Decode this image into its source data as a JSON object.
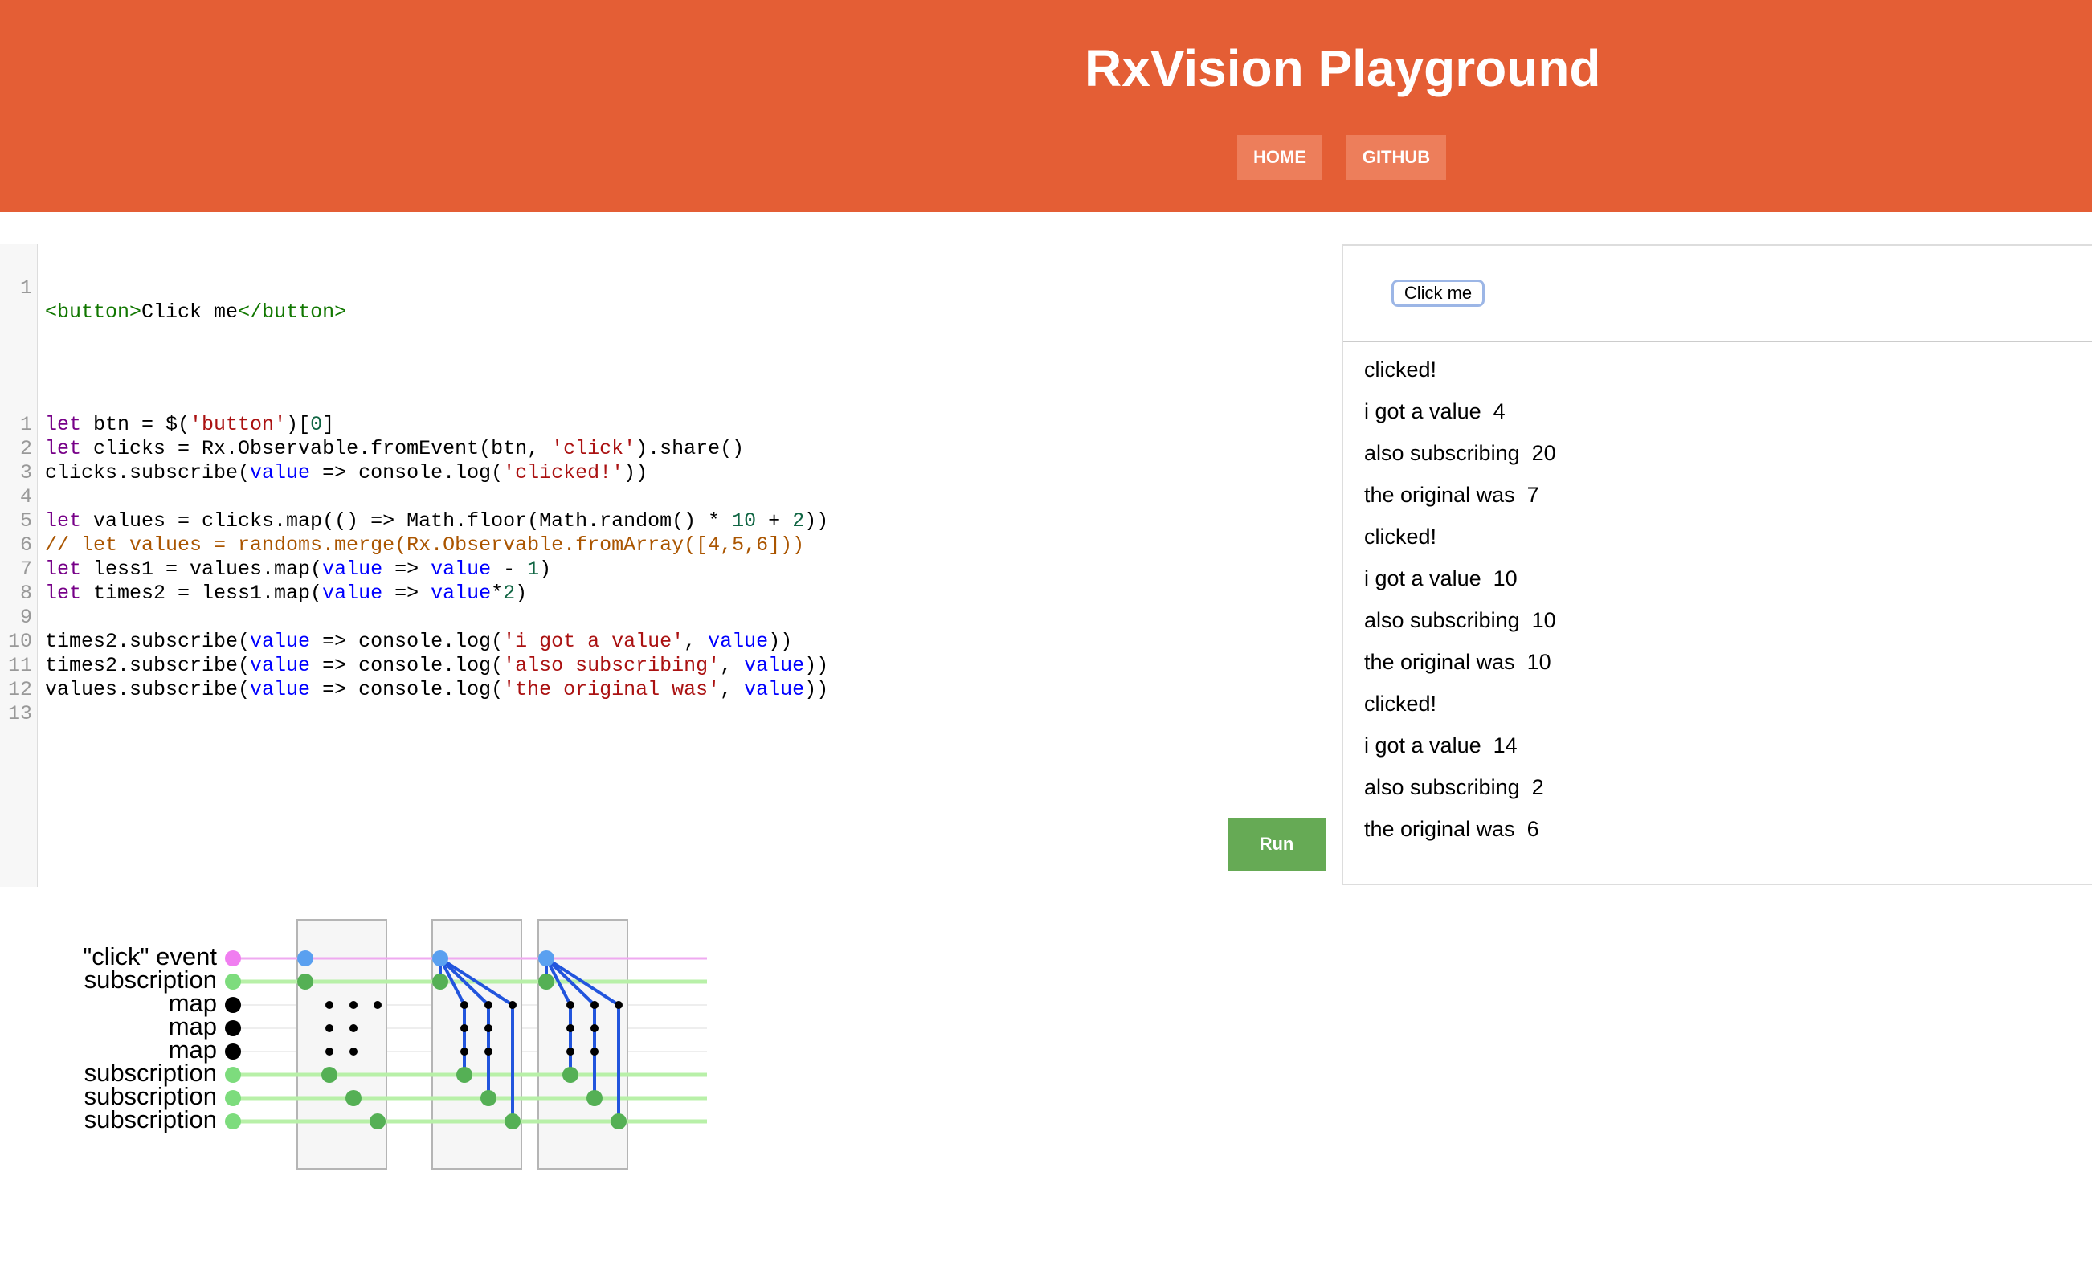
{
  "header": {
    "title": "RxVision Playground",
    "nav": [
      "HOME",
      "GITHUB"
    ],
    "bg_color": "#e45e35"
  },
  "html_editor": {
    "lines": [
      {
        "num": "1",
        "text": "<button>Click me</button>"
      }
    ]
  },
  "js_editor": {
    "lines": [
      {
        "num": "1",
        "text": "let btn = $('button')[0]"
      },
      {
        "num": "2",
        "text": "let clicks = Rx.Observable.fromEvent(btn, 'click').share()"
      },
      {
        "num": "3",
        "text": "clicks.subscribe(value => console.log('clicked!'))"
      },
      {
        "num": "4",
        "text": ""
      },
      {
        "num": "5",
        "text": "let values = clicks.map(() => Math.floor(Math.random() * 10 + 2))"
      },
      {
        "num": "6",
        "text": "// let values = randoms.merge(Rx.Observable.fromArray([4,5,6]))"
      },
      {
        "num": "7",
        "text": "let less1 = values.map(value => value - 1)"
      },
      {
        "num": "8",
        "text": "let times2 = less1.map(value => value*2)"
      },
      {
        "num": "9",
        "text": ""
      },
      {
        "num": "10",
        "text": "times2.subscribe(value => console.log('i got a value', value))"
      },
      {
        "num": "11",
        "text": "times2.subscribe(value => console.log('also subscribing', value))"
      },
      {
        "num": "12",
        "text": "values.subscribe(value => console.log('the original was', value))"
      },
      {
        "num": "13",
        "text": ""
      }
    ]
  },
  "run_button": "Run",
  "preview": {
    "button": "Click me",
    "log": [
      "clicked!",
      "i got a value  4",
      "also subscribing  20",
      "the original was  7",
      "clicked!",
      "i got a value  10",
      "also subscribing  10",
      "the original was  10",
      "clicked!",
      "i got a value  14",
      "also subscribing  2",
      "the original was  6"
    ]
  },
  "visualization": {
    "rows": [
      "\"click\" event",
      "subscription",
      "map",
      "map",
      "map",
      "subscription",
      "subscription",
      "subscription"
    ],
    "row_kinds": [
      "event",
      "subscription",
      "map",
      "map",
      "map",
      "subscription",
      "subscription",
      "subscription"
    ],
    "colors": {
      "event": "#f07ef0",
      "event_line": "#efaaf0",
      "subscription": "#7ddc7d",
      "subscription_line": "#b8f0a8",
      "emission": "#5aa0f0",
      "value_dot": "#55b055",
      "link": "#2255dd",
      "map": "#000000"
    },
    "click_count": 3
  }
}
